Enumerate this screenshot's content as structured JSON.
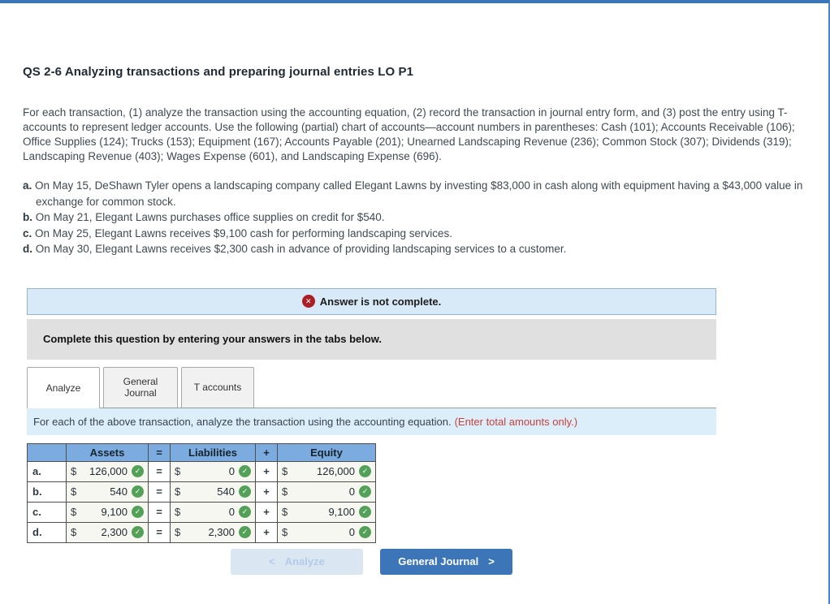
{
  "page": {
    "title": "QS 2-6 Analyzing transactions and preparing journal entries LO P1",
    "intro": "For each transaction, (1) analyze the transaction using the accounting equation, (2) record the transaction in journal entry form, and (3) post the entry using T-accounts to represent ledger accounts. Use the following (partial) chart of accounts—account numbers in parentheses: Cash (101); Accounts Receivable (106); Office Supplies (124); Trucks (153); Equipment (167); Accounts Payable (201); Unearned Landscaping Revenue (236); Common Stock (307); Dividends (319); Landscaping Revenue (403); Wages Expense (601), and Landscaping Expense (696)."
  },
  "transactions": [
    {
      "label": "a.",
      "text": "On May 15, DeShawn Tyler opens a landscaping company called Elegant Lawns by investing $83,000 in cash along with equipment having a $43,000 value in exchange for common stock."
    },
    {
      "label": "b.",
      "text": "On May 21, Elegant Lawns purchases office supplies on credit for $540."
    },
    {
      "label": "c.",
      "text": "On May 25, Elegant Lawns receives $9,100 cash for performing landscaping services."
    },
    {
      "label": "d.",
      "text": "On May 30, Elegant Lawns receives $2,300 cash in advance of providing landscaping services to a customer."
    }
  ],
  "status_banner": {
    "text": "Answer is not complete."
  },
  "gray_banner": {
    "text": "Complete this question by entering your answers in the tabs below."
  },
  "tabs": [
    {
      "label": "Analyze"
    },
    {
      "label": "General Journal"
    },
    {
      "label": "T accounts"
    }
  ],
  "tab_instruction": {
    "text": "For each of the above transaction, analyze the transaction using the accounting equation.",
    "note": "(Enter total amounts only.)"
  },
  "table": {
    "currency": "$",
    "headers": {
      "assets": "Assets",
      "liabilities": "Liabilities",
      "equity": "Equity"
    },
    "ops": {
      "eq": "=",
      "plus": "+"
    },
    "rows": [
      {
        "label": "a.",
        "assets": "126,000",
        "liabilities": "0",
        "equity": "126,000"
      },
      {
        "label": "b.",
        "assets": "540",
        "liabilities": "540",
        "equity": "0"
      },
      {
        "label": "c.",
        "assets": "9,100",
        "liabilities": "0",
        "equity": "9,100"
      },
      {
        "label": "d.",
        "assets": "2,300",
        "liabilities": "2,300",
        "equity": "0"
      }
    ]
  },
  "buttons": {
    "prev": "Analyze",
    "next": "General Journal"
  },
  "icons": {
    "check": "✓",
    "error": "✕",
    "chevron_left": "<",
    "chevron_right": ">"
  },
  "colors": {
    "accent_blue": "#3d76b8",
    "header_blue": "#7cacdf",
    "banner_blue": "#d8eaf8",
    "error_red": "#ab1f24",
    "note_red": "#c9403c",
    "check_green": "#53a058"
  }
}
